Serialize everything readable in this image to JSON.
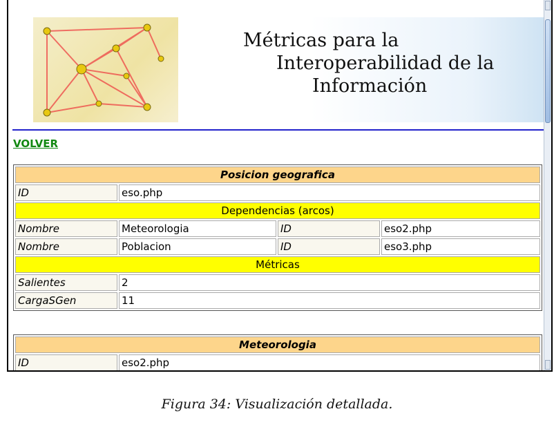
{
  "banner": {
    "title_line1": "Métricas para la",
    "title_line2": "Interoperabilidad de la",
    "title_line3": "Información"
  },
  "nav": {
    "volver": "VOLVER"
  },
  "tables": [
    {
      "title": "Posicion geografica",
      "id_label": "ID",
      "id_value": "eso.php",
      "deps_header": "Dependencias (arcos)",
      "deps": [
        {
          "name_label": "Nombre",
          "name": "Meteorologia",
          "id_label": "ID",
          "id": "eso2.php"
        },
        {
          "name_label": "Nombre",
          "name": "Poblacion",
          "id_label": "ID",
          "id": "eso3.php"
        }
      ],
      "metrics_header": "Métricas",
      "metrics": [
        {
          "label": "Salientes",
          "value": "2"
        },
        {
          "label": "CargaSGen",
          "value": "11"
        }
      ]
    },
    {
      "title": "Meteorologia",
      "id_label": "ID",
      "id_value": "eso2.php"
    }
  ],
  "caption": "Figura 34: Visualización detallada.",
  "colors": {
    "header_bg": "#fdd58b",
    "subheader_bg": "#ffff00",
    "link": "#118811",
    "rule": "#2222cc"
  }
}
